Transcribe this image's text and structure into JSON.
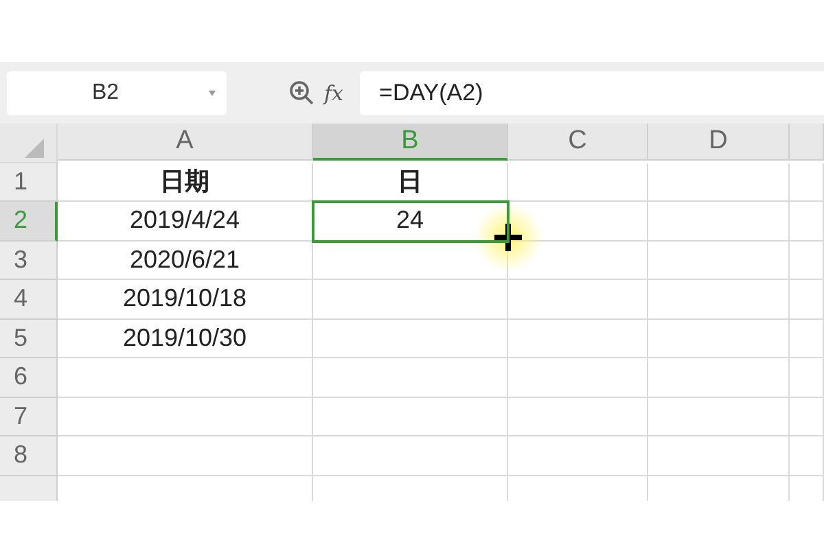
{
  "name_box": {
    "value": "B2"
  },
  "formula_bar": {
    "function_label": "fx",
    "value": "=DAY(A2)"
  },
  "columns": [
    {
      "label": "A",
      "selected": false
    },
    {
      "label": "B",
      "selected": true
    },
    {
      "label": "C",
      "selected": false
    },
    {
      "label": "D",
      "selected": false
    }
  ],
  "rows": [
    {
      "number": "1",
      "selected": false,
      "cells": [
        {
          "value": "日期",
          "bold": true,
          "selected": false
        },
        {
          "value": "日",
          "bold": true,
          "selected": false
        }
      ]
    },
    {
      "number": "2",
      "selected": true,
      "cells": [
        {
          "value": "2019/4/24",
          "bold": false,
          "selected": false
        },
        {
          "value": "24",
          "bold": false,
          "selected": true
        }
      ]
    },
    {
      "number": "3",
      "selected": false,
      "cells": [
        {
          "value": "2020/6/21",
          "bold": false,
          "selected": false
        }
      ]
    },
    {
      "number": "4",
      "selected": false,
      "cells": [
        {
          "value": "2019/10/18",
          "bold": false,
          "selected": false
        }
      ]
    },
    {
      "number": "5",
      "selected": false,
      "cells": [
        {
          "value": "2019/10/30",
          "bold": false,
          "selected": false
        }
      ]
    },
    {
      "number": "6",
      "selected": false,
      "cells": []
    },
    {
      "number": "7",
      "selected": false,
      "cells": []
    },
    {
      "number": "8",
      "selected": false,
      "cells": []
    }
  ]
}
